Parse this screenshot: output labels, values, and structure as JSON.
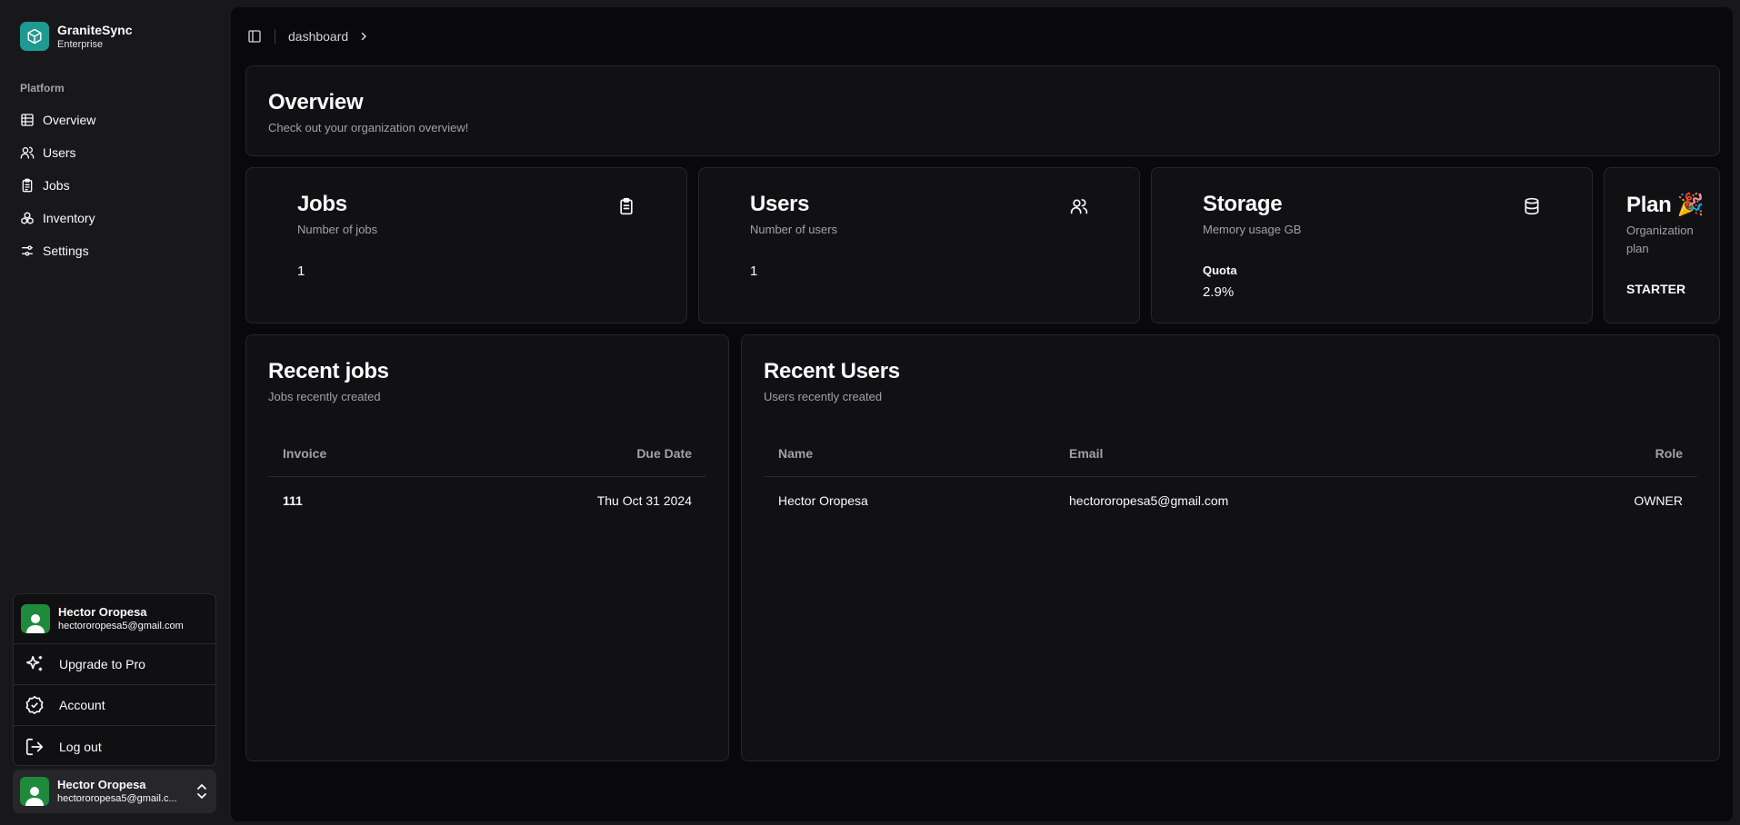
{
  "brand": {
    "name": "GraniteSync",
    "tier": "Enterprise"
  },
  "sidebar": {
    "group_label": "Platform",
    "items": [
      {
        "label": "Overview",
        "icon": "table-icon"
      },
      {
        "label": "Users",
        "icon": "users-icon"
      },
      {
        "label": "Jobs",
        "icon": "clipboard-icon"
      },
      {
        "label": "Inventory",
        "icon": "boxes-icon"
      },
      {
        "label": "Settings",
        "icon": "sliders-icon"
      }
    ]
  },
  "user_menu": {
    "name": "Hector Oropesa",
    "email": "hectororopesa5@gmail.com",
    "items": [
      {
        "label": "Upgrade to Pro",
        "icon": "sparkles-icon"
      },
      {
        "label": "Account",
        "icon": "badge-check-icon"
      },
      {
        "label": "Log out",
        "icon": "log-out-icon"
      }
    ]
  },
  "user_footer": {
    "name": "Hector Oropesa",
    "email": "hectororopesa5@gmail.c..."
  },
  "breadcrumb": {
    "current": "dashboard"
  },
  "overview": {
    "title": "Overview",
    "subtitle": "Check out your organization overview!"
  },
  "stats": {
    "jobs": {
      "title": "Jobs",
      "subtitle": "Number of jobs",
      "value": "1"
    },
    "users": {
      "title": "Users",
      "subtitle": "Number of users",
      "value": "1"
    },
    "storage": {
      "title": "Storage",
      "subtitle": "Memory usage GB",
      "quota_label": "Quota",
      "quota_value": "2.9%"
    },
    "plan": {
      "title": "Plan 🎉",
      "subtitle": "Organization plan",
      "value": "STARTER"
    }
  },
  "recent_jobs": {
    "title": "Recent jobs",
    "subtitle": "Jobs recently created",
    "columns": [
      "Invoice",
      "Due Date"
    ],
    "rows": [
      {
        "invoice": "111",
        "due_date": "Thu Oct 31 2024"
      }
    ]
  },
  "recent_users": {
    "title": "Recent Users",
    "subtitle": "Users recently created",
    "columns": [
      "Name",
      "Email",
      "Role"
    ],
    "rows": [
      {
        "name": "Hector Oropesa",
        "email": "hectororopesa5@gmail.com",
        "role": "OWNER"
      }
    ]
  },
  "colors": {
    "brand_accent": "#1f9a93",
    "avatar": "#1f8a3c",
    "background": "#09090b",
    "card": "#111113"
  }
}
